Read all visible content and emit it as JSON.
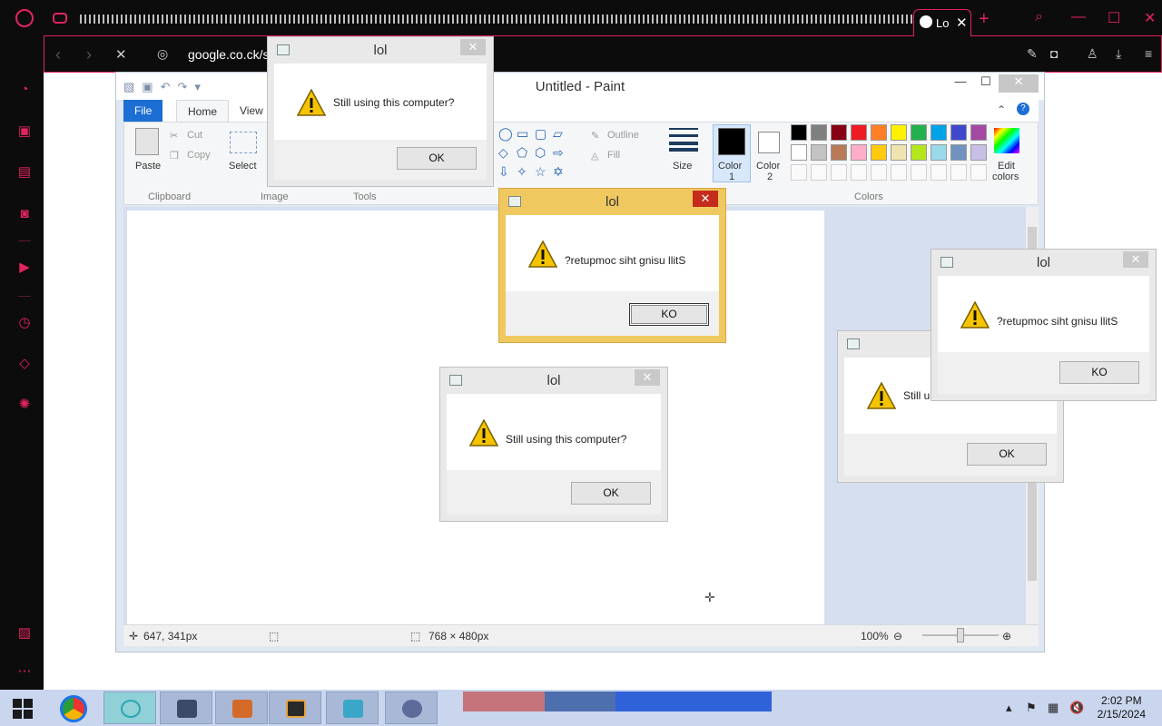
{
  "browser": {
    "active_tab_title": "Lo",
    "url": "google.co.ck/se"
  },
  "paint": {
    "title": "Untitled - Paint",
    "tabs": {
      "file": "File",
      "home": "Home",
      "view": "View"
    },
    "clipboard": {
      "paste": "Paste",
      "cut": "Cut",
      "copy": "Copy",
      "group": "Clipboard"
    },
    "image": {
      "select": "Select",
      "group": "Image"
    },
    "tools": {
      "group": "Tools"
    },
    "shapes": {
      "outline": "Outline",
      "fill": "Fill"
    },
    "size_label": "Size",
    "color1": {
      "line1": "Color",
      "line2": "1"
    },
    "color2": {
      "line1": "Color",
      "line2": "2"
    },
    "edit_colors": {
      "line1": "Edit",
      "line2": "colors"
    },
    "colors_group": "Colors",
    "status": {
      "cursor_pos": "647, 341px",
      "canvas_size": "768 × 480px",
      "zoom": "100%"
    },
    "palette": [
      "#000000",
      "#7f7f7f",
      "#880015",
      "#ed1c24",
      "#ff7f27",
      "#fff200",
      "#22b14c",
      "#00a2e8",
      "#3f48cc",
      "#a349a4",
      "#ffffff",
      "#c3c3c3",
      "#b97a57",
      "#ffaec9",
      "#ffc90e",
      "#efe4b0",
      "#b5e61d",
      "#99d9ea",
      "#7092be",
      "#c8bfe7"
    ]
  },
  "dialogs": [
    {
      "title": "lol",
      "message": "Still using this computer?",
      "button": "OK"
    },
    {
      "title": "lol",
      "message": "?retupmoc siht gnisu llitS",
      "button": "KO"
    },
    {
      "title": "lol",
      "message": "Still using this computer?",
      "button": "OK"
    },
    {
      "title": "",
      "message": "Still u",
      "button": "OK"
    },
    {
      "title": "lol",
      "message": "?retupmoc siht gnisu llitS",
      "button": "KO"
    }
  ],
  "taskbar": {
    "time": "2:02 PM",
    "date": "2/15/2024"
  }
}
